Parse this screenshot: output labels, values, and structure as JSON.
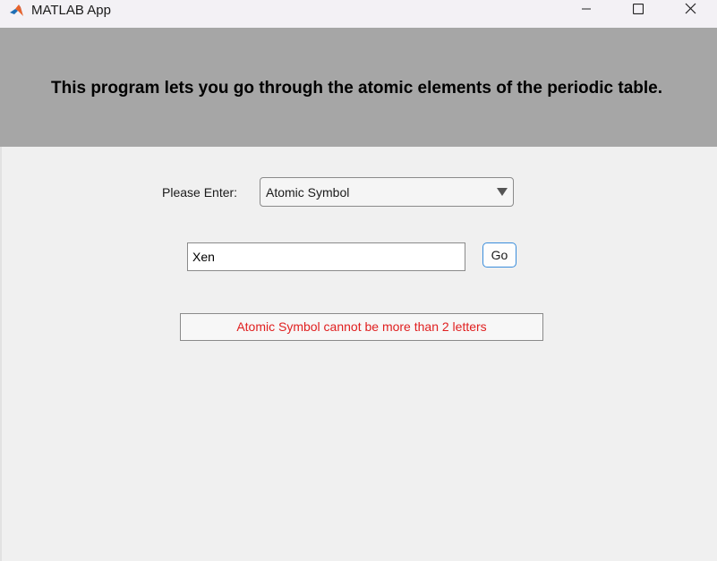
{
  "window": {
    "title": "MATLAB App",
    "icon": "matlab-logo-icon",
    "controls": {
      "minimize": "minimize-icon",
      "maximize": "maximize-icon",
      "close": "close-icon"
    }
  },
  "header": {
    "text": "This program lets you go through the atomic elements of the periodic table.",
    "background": "#a6a6a6"
  },
  "form": {
    "prompt_label": "Please Enter:",
    "mode_dropdown": {
      "selected": "Atomic Symbol"
    },
    "input_value": "Xen",
    "go_label": "Go"
  },
  "status": {
    "message": "Atomic Symbol cannot be more than 2 letters",
    "color": "#e02020"
  }
}
